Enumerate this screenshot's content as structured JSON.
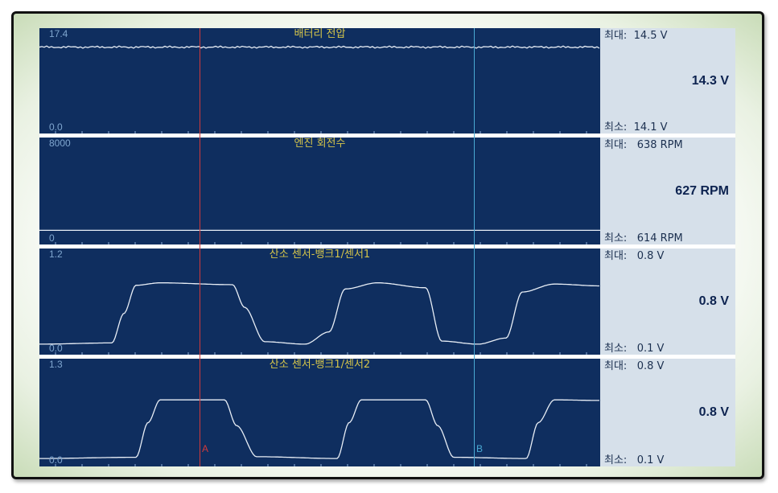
{
  "panels": [
    {
      "title": "배터리 전압",
      "y_top": "17.4",
      "y_bot": "0.0",
      "max_label": "최대:  14.5 V",
      "min_label": "최소:  14.1 V",
      "current": "14.3 V",
      "signal": {
        "kind": "flat_noise",
        "level": 14.3,
        "range": [
          0,
          17.4
        ]
      }
    },
    {
      "title": "엔진 회전수",
      "y_top": "8000",
      "y_bot": "0",
      "max_label": "최대:   638 RPM",
      "min_label": "최소:   614 RPM",
      "current": "627 RPM",
      "signal": {
        "kind": "flat",
        "level": 627,
        "range": [
          0,
          8000
        ]
      }
    },
    {
      "title": "산소 센서-뱅크1/센서1",
      "y_top": "1.2",
      "y_bot": "0.0",
      "max_label": "최대:   0.8 V",
      "min_label": "최소:   0.1 V",
      "current": "0.8 V",
      "signal": {
        "kind": "square",
        "high": 0.8,
        "low": 0.05,
        "range": [
          0,
          1.2
        ],
        "phase": "s1"
      }
    },
    {
      "title": "산소 센서-뱅크1/센서2",
      "y_top": "1.3",
      "y_bot": "0.0",
      "max_label": "최대:   0.8 V",
      "min_label": "최소:   0.1 V",
      "current": "0.8 V",
      "signal": {
        "kind": "square",
        "high": 0.8,
        "low": 0.02,
        "range": [
          0,
          1.3
        ],
        "phase": "s2"
      }
    }
  ],
  "cursors": {
    "a_label": "A",
    "b_label": "B"
  },
  "colors": {
    "plot_bg": "#0f2e5f",
    "trace": "#e8eef6",
    "title": "#d4c44a",
    "cursor_a": "#d23a3a",
    "cursor_b": "#49a9d4"
  }
}
